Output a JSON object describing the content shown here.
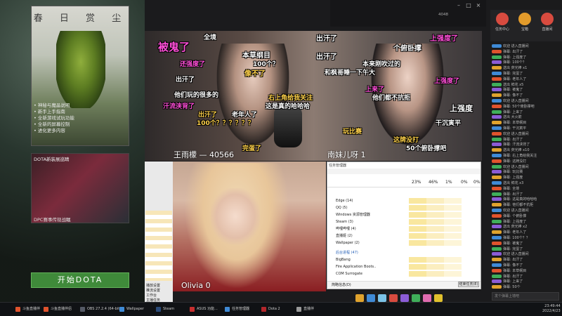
{
  "launcher": {
    "hero_title": "春 日 赏 尘",
    "hero_features": [
      "• 神秘与魔晶说明",
      "• 新手上手指南",
      "• 全新游戏试玩功能",
      "• 全新的屏幕控制",
      "• 进化更多内容"
    ],
    "promo_title": "DOTA新装展巡睛",
    "promo_sub": "DPC赛事传现战瞩",
    "start_button": "开始DOTA"
  },
  "stream": {
    "nameplate_left": "王雨檬 — 40566",
    "nameplate_right": "南妹儿呀 1",
    "olivia_tag": "Olivia  0",
    "top_info": "4048"
  },
  "danmaku": [
    {
      "text": "全境",
      "color": "#ffffff"
    },
    {
      "text": "出汗了",
      "color": "#ffffff"
    },
    {
      "text": "被鬼了",
      "color": "#ff4fd8"
    },
    {
      "text": "本草纲目",
      "color": "#ffffff"
    },
    {
      "text": "上强度了",
      "color": "#ff4fd8"
    },
    {
      "text": "个俯卧撑",
      "color": "#ffffff"
    },
    {
      "text": "出汗了",
      "color": "#ffffff"
    },
    {
      "text": "还强度了",
      "color": "#ff4fd8"
    },
    {
      "text": "100个？",
      "color": "#ffffff"
    },
    {
      "text": "和枫哥睡一下午大",
      "color": "#ffffff"
    },
    {
      "text": "本来刚吹过的",
      "color": "#ffffff"
    },
    {
      "text": "像不了",
      "color": "#ffd24a"
    },
    {
      "text": "出汗了",
      "color": "#ffffff"
    },
    {
      "text": "他们都不抗拒",
      "color": "#ffffff"
    },
    {
      "text": "上来了",
      "color": "#ff4fd8"
    },
    {
      "text": "100个？？？？？？",
      "color": "#ffd24a"
    },
    {
      "text": "汗流浃背了",
      "color": "#ff4fd8"
    },
    {
      "text": "出汗了",
      "color": "#ffd24a"
    },
    {
      "text": "右上角给我关注",
      "color": "#ffd24a"
    },
    {
      "text": "干沉寅平",
      "color": "#ffffff"
    },
    {
      "text": "50个俯卧撑吧",
      "color": "#ffffff"
    },
    {
      "text": "这牌没打",
      "color": "#ffd24a"
    },
    {
      "text": "完蛋了",
      "color": "#ffd24a"
    },
    {
      "text": "老年人了",
      "color": "#ffffff"
    },
    {
      "text": "这是真的哈哈哈",
      "color": "#ffffff"
    },
    {
      "text": "上强度了",
      "color": "#ff4fd8"
    },
    {
      "text": "玩比赛",
      "color": "#ffd24a"
    },
    {
      "text": "他们玩的很多的",
      "color": "#ffffff"
    },
    {
      "text": "上强度",
      "color": "#ffffff"
    }
  ],
  "taskmgr": {
    "title": "任务管理器",
    "pct": [
      "23%",
      "46%",
      "1%",
      "0%",
      "0%"
    ],
    "rows": [
      "Edge (14)",
      "QQ (5)",
      "Windows 资源管理器",
      "Steam (3)",
      "哔哩哔哩 (4)",
      "直播姬 (2)",
      "Wallpaper (2)",
      "后台进程 (47)",
      "BigBang",
      "Fire Application Boots..",
      "COM Surrogate"
    ],
    "fewer_details": "简略信息(D)",
    "end_task": "结束任务(E)"
  },
  "small_window": {
    "labels": [
      "播放设置",
      "推流设置",
      "工作台",
      "主播任务",
      "更多"
    ]
  },
  "rightpanel": {
    "icons": [
      {
        "label": "任务中心",
        "color": "#d84b3f"
      },
      {
        "label": "宝箱",
        "color": "#e29b2b"
      },
      {
        "label": "直播间",
        "color": "#d84b3f"
      }
    ],
    "chat": [
      "欢迎 进入直播间",
      "弹幕: 出汗了",
      "弹幕: 上强度了",
      "弹幕: 100个？",
      "送出 荧光棒 x1",
      "弹幕: 完蛋了",
      "弹幕: 老年人了",
      "送出 鲜花 x5",
      "弹幕: 被鬼了",
      "弹幕: 像不了",
      "欢迎 进入直播间",
      "弹幕: 50个俯卧撑吧",
      "弹幕: 上来了",
      "送出 大火箭",
      "弹幕: 本草纲目",
      "弹幕: 干沉寅平",
      "欢迎 进入直播间",
      "弹幕: 出汗了",
      "弹幕: 汗流浃背了",
      "送出 荧光棒 x10",
      "弹幕: 右上角给我关注",
      "弹幕: 这牌没打",
      "欢迎 进入直播间",
      "弹幕: 玩比赛",
      "弹幕: 上强度",
      "送出 鲜花 x3",
      "弹幕: 全境",
      "弹幕: 出汗了",
      "弹幕: 这是真的哈哈哈",
      "弹幕: 他们都不抗拒",
      "欢迎 进入直播间",
      "弹幕: 个俯卧撑",
      "弹幕: 上强度了",
      "送出 荧光棒 x2",
      "弹幕: 老年人了",
      "弹幕: 100个？？",
      "弹幕: 被鬼了",
      "弹幕: 完蛋了",
      "欢迎 进入直播间",
      "弹幕: 出汗了",
      "弹幕: 像不了",
      "弹幕: 本草纲目",
      "弹幕: 出汗了",
      "弹幕: 上来了",
      "弹幕: 50个"
    ],
    "input_placeholder": "发个弹幕上墙吧"
  },
  "taskbar": {
    "items": [
      {
        "label": "斗鱼直播伴",
        "color": "#e0532d"
      },
      {
        "label": "斗鱼直播伴侣",
        "color": "#e0532d"
      },
      {
        "label": "OBS 27.2.4 (64-bit..",
        "color": "#555a66"
      },
      {
        "label": "Wallpaper",
        "color": "#3f8ad6"
      },
      {
        "label": "Steam",
        "color": "#2b4b7a"
      },
      {
        "label": "ASUS 功能...",
        "color": "#c72f2f"
      },
      {
        "label": "任务管理器",
        "color": "#3f8ad6"
      },
      {
        "label": "Dota 2",
        "color": "#b3262b"
      },
      {
        "label": "直播伴",
        "color": "#9a9a9a"
      }
    ],
    "time": "23:49:44",
    "date": "2022/4/23"
  },
  "colors": {
    "start_button": "#3f8a3a",
    "danmaku_pink": "#ff4fd8",
    "danmaku_yellow": "#ffd24a",
    "taskbar_bg": "#101215"
  }
}
